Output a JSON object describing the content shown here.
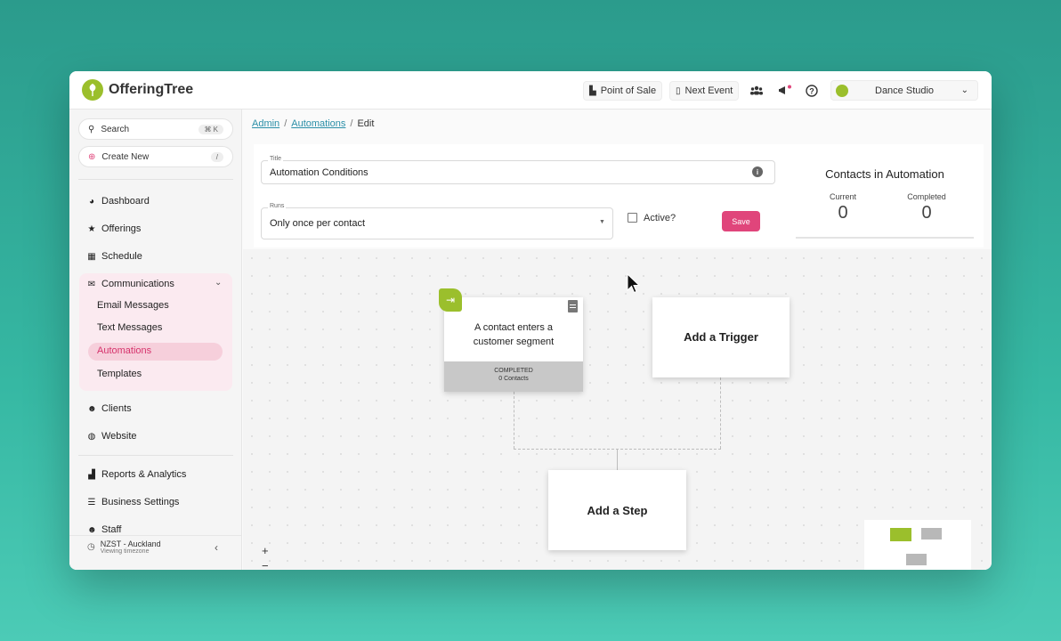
{
  "app": {
    "name": "OfferingTree"
  },
  "header": {
    "point_of_sale": "Point of Sale",
    "next_event": "Next Event",
    "studio": "Dance Studio"
  },
  "sidebar": {
    "search_label": "Search",
    "search_shortcut": "⌘ K",
    "create_label": "Create New",
    "create_shortcut": "/",
    "items": [
      {
        "label": "Dashboard",
        "icon": "dashboard-icon"
      },
      {
        "label": "Offerings",
        "icon": "star-icon"
      },
      {
        "label": "Schedule",
        "icon": "calendar-icon"
      },
      {
        "label": "Communications",
        "icon": "mail-icon"
      },
      {
        "label": "Clients",
        "icon": "people-icon"
      },
      {
        "label": "Website",
        "icon": "globe-icon"
      },
      {
        "label": "Reports & Analytics",
        "icon": "chart-icon"
      },
      {
        "label": "Business Settings",
        "icon": "sliders-icon"
      },
      {
        "label": "Staff",
        "icon": "staff-icon"
      }
    ],
    "communications_sub": [
      "Email Messages",
      "Text Messages",
      "Automations",
      "Templates"
    ],
    "active_sub": "Automations",
    "timezone": "NZST - Auckland",
    "timezone_caption": "Viewing timezone"
  },
  "breadcrumb": {
    "admin": "Admin",
    "automations": "Automations",
    "current": "Edit"
  },
  "form": {
    "title_label": "Title",
    "title_value": "Automation Conditions",
    "runs_label": "Runs",
    "runs_value": "Only once per contact",
    "active_label": "Active?",
    "active_checked": false,
    "save_label": "Save"
  },
  "contacts": {
    "heading": "Contacts in Automation",
    "current_label": "Current",
    "current_value": "0",
    "completed_label": "Completed",
    "completed_value": "0"
  },
  "canvas": {
    "trigger_text_1": "A contact enters a",
    "trigger_text_2": "customer segment",
    "trigger_status": "COMPLETED",
    "trigger_contacts": "0 Contacts",
    "add_trigger": "Add a Trigger",
    "add_step": "Add a Step",
    "zoom_in": "+",
    "zoom_out": "−"
  },
  "colors": {
    "accent": "#e0457b",
    "brand": "#9bbf2c",
    "link": "#2b8fa8"
  }
}
